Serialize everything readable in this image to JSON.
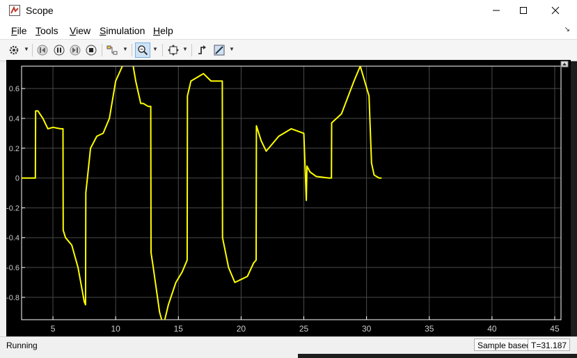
{
  "window": {
    "title": "Scope"
  },
  "menu": [
    "File",
    "Tools",
    "View",
    "Simulation",
    "Help"
  ],
  "status": {
    "text": "Running",
    "sample_mode": "Sample based",
    "time": "T=31.187"
  },
  "chart_data": {
    "type": "line",
    "xlim": [
      2.5,
      45.5
    ],
    "ylim": [
      -0.95,
      0.75
    ],
    "xticks": [
      5,
      10,
      15,
      20,
      25,
      30,
      35,
      40,
      45
    ],
    "yticks": [
      0.6,
      0.4,
      0.2,
      0,
      -0.2,
      -0.4,
      -0.6,
      -0.8
    ],
    "ytick_labels": [
      "0.6",
      "0.4",
      "0.2",
      "0",
      "-0.2",
      "-0.4",
      "-0.6",
      "-0.8"
    ],
    "grid": true,
    "background": "#000000",
    "line_color": "#ffff00",
    "axis_color": "#ffffff",
    "series": [
      {
        "x": [
          2.5,
          3.6,
          3.62,
          3.8,
          4.2,
          4.6,
          5.0,
          5.6,
          5.8,
          5.82,
          6.0,
          6.5,
          7.0,
          7.5,
          7.6,
          7.62,
          8.0,
          8.5,
          9.0,
          9.5,
          10.0,
          10.8,
          11.3,
          11.6,
          12.0,
          12.2,
          12.6,
          12.8,
          12.82,
          13.0,
          13.5,
          13.8,
          14.2,
          14.8,
          15.3,
          15.7,
          15.72,
          16.0,
          16.6,
          17.0,
          17.6,
          18.0,
          18.5,
          18.52,
          19.0,
          19.5,
          20.0,
          20.5,
          21.0,
          21.2,
          21.22,
          21.6,
          22.0,
          23.0,
          24.0,
          25.0,
          25.2,
          25.25,
          25.5,
          26.0,
          27.0,
          27.2,
          27.22,
          28.0,
          29.0,
          29.5,
          30.2,
          30.4,
          30.6,
          31.0,
          31.2
        ],
        "y": [
          0,
          0,
          0.45,
          0.45,
          0.4,
          0.33,
          0.34,
          0.33,
          0.33,
          -0.35,
          -0.4,
          -0.45,
          -0.6,
          -0.83,
          -0.85,
          -0.1,
          0.2,
          0.28,
          0.3,
          0.4,
          0.65,
          0.8,
          0.8,
          0.65,
          0.5,
          0.5,
          0.48,
          0.48,
          -0.5,
          -0.6,
          -0.9,
          -0.99,
          -0.85,
          -0.7,
          -0.63,
          -0.55,
          0.55,
          0.65,
          0.68,
          0.7,
          0.65,
          0.65,
          0.65,
          -0.4,
          -0.6,
          -0.7,
          -0.68,
          -0.66,
          -0.57,
          -0.55,
          0.35,
          0.25,
          0.18,
          0.28,
          0.33,
          0.3,
          -0.15,
          0.08,
          0.04,
          0.01,
          0,
          0,
          0.37,
          0.43,
          0.65,
          0.75,
          0.55,
          0.1,
          0.02,
          0,
          0
        ]
      }
    ]
  }
}
